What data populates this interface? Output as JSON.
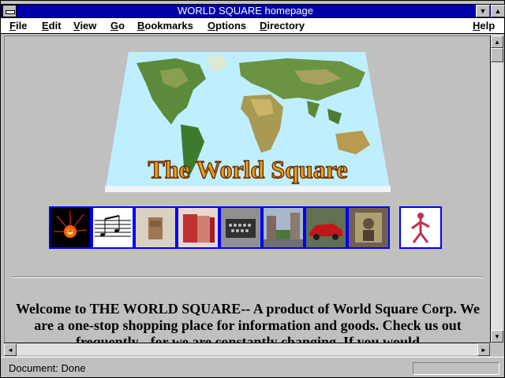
{
  "window": {
    "title": "WORLD SQUARE homepage",
    "minimize_glyph": "▼",
    "maximize_glyph": "▲"
  },
  "menubar": {
    "items": [
      {
        "label": "File"
      },
      {
        "label": "Edit"
      },
      {
        "label": "View"
      },
      {
        "label": "Go"
      },
      {
        "label": "Bookmarks"
      },
      {
        "label": "Options"
      },
      {
        "label": "Directory"
      },
      {
        "label": "Help"
      }
    ]
  },
  "banner": {
    "text": "The World Square"
  },
  "thumbnails": [
    {
      "icon": "fireworks-icon"
    },
    {
      "icon": "music-notes-icon"
    },
    {
      "icon": "bag-icon"
    },
    {
      "icon": "books-icon"
    },
    {
      "icon": "typewriter-icon"
    },
    {
      "icon": "city-street-icon"
    },
    {
      "icon": "car-icon"
    },
    {
      "icon": "painting-icon"
    },
    {
      "icon": "figure-icon"
    }
  ],
  "content": {
    "welcome_text": "Welcome to THE WORLD SQUARE-- A product of World Square Corp. We are a one-stop shopping place for information and goods. Check us out frequently - for we are constantly changing. If you would"
  },
  "scrollbars": {
    "up_glyph": "▲",
    "down_glyph": "▼",
    "left_glyph": "◄",
    "right_glyph": "►"
  },
  "status": {
    "text": "Document: Done"
  },
  "colors": {
    "titlebar": "#0000a8",
    "window_bg": "#c0c0c0",
    "link_border": "#0000ff"
  }
}
